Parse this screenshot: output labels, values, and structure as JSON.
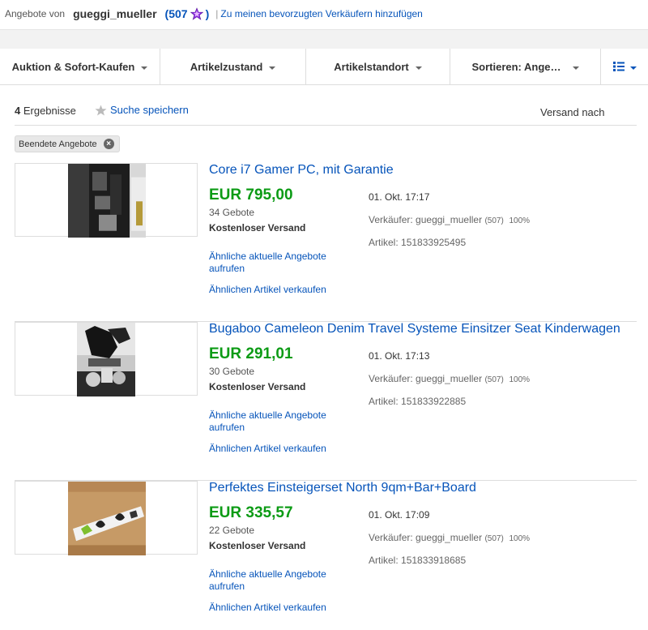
{
  "header": {
    "label": "Angebote von",
    "seller_name": "gueggi_mueller",
    "paren_open": "(",
    "score": "507",
    "paren_close": ")",
    "separator": "|",
    "favorite_link": "Zu meinen bevorzugten Verkäufern hinzufügen",
    "star_color": "#8a2be2"
  },
  "filters": {
    "buying_format": "Auktion & Sofort-Kaufen",
    "condition": "Artikelzustand",
    "location": "Artikelstandort",
    "sort": "Sortieren: Ange…",
    "view_icon": "list-view-icon"
  },
  "results": {
    "count": "4",
    "count_label": " Ergebnisse",
    "save_search": "Suche speichern",
    "ship_to": "Versand nach"
  },
  "chip": {
    "label": "Beendete Angebote",
    "remove": "×"
  },
  "common": {
    "shipping": "Kostenloser Versand",
    "similar_current": "Ähnliche aktuelle Angebote aufrufen",
    "sell_similar": "Ähnlichen Artikel verkaufen",
    "seller_prefix": "Verkäufer:",
    "seller_name": "gueggi_mueller",
    "seller_score": "(507)",
    "seller_percent": "100%",
    "artikel_prefix": "Artikel:"
  },
  "items": [
    {
      "title": "Core i7 Gamer PC, mit Garantie",
      "price": "EUR 795,00",
      "bids": "34 Gebote",
      "date": "01. Okt. 17:17",
      "item_number": "151833925495"
    },
    {
      "title": "Bugaboo Cameleon Denim Travel Systeme Einsitzer Seat Kinderwagen",
      "price": "EUR 291,01",
      "bids": "30 Gebote",
      "date": "01. Okt. 17:13",
      "item_number": "151833922885"
    },
    {
      "title": "Perfektes Einsteigerset North 9qm+Bar+Board",
      "price": "EUR 335,57",
      "bids": "22 Gebote",
      "date": "01. Okt. 17:09",
      "item_number": "151833918685"
    }
  ],
  "colors": {
    "link": "#0654ba",
    "price": "#0c9b15"
  }
}
